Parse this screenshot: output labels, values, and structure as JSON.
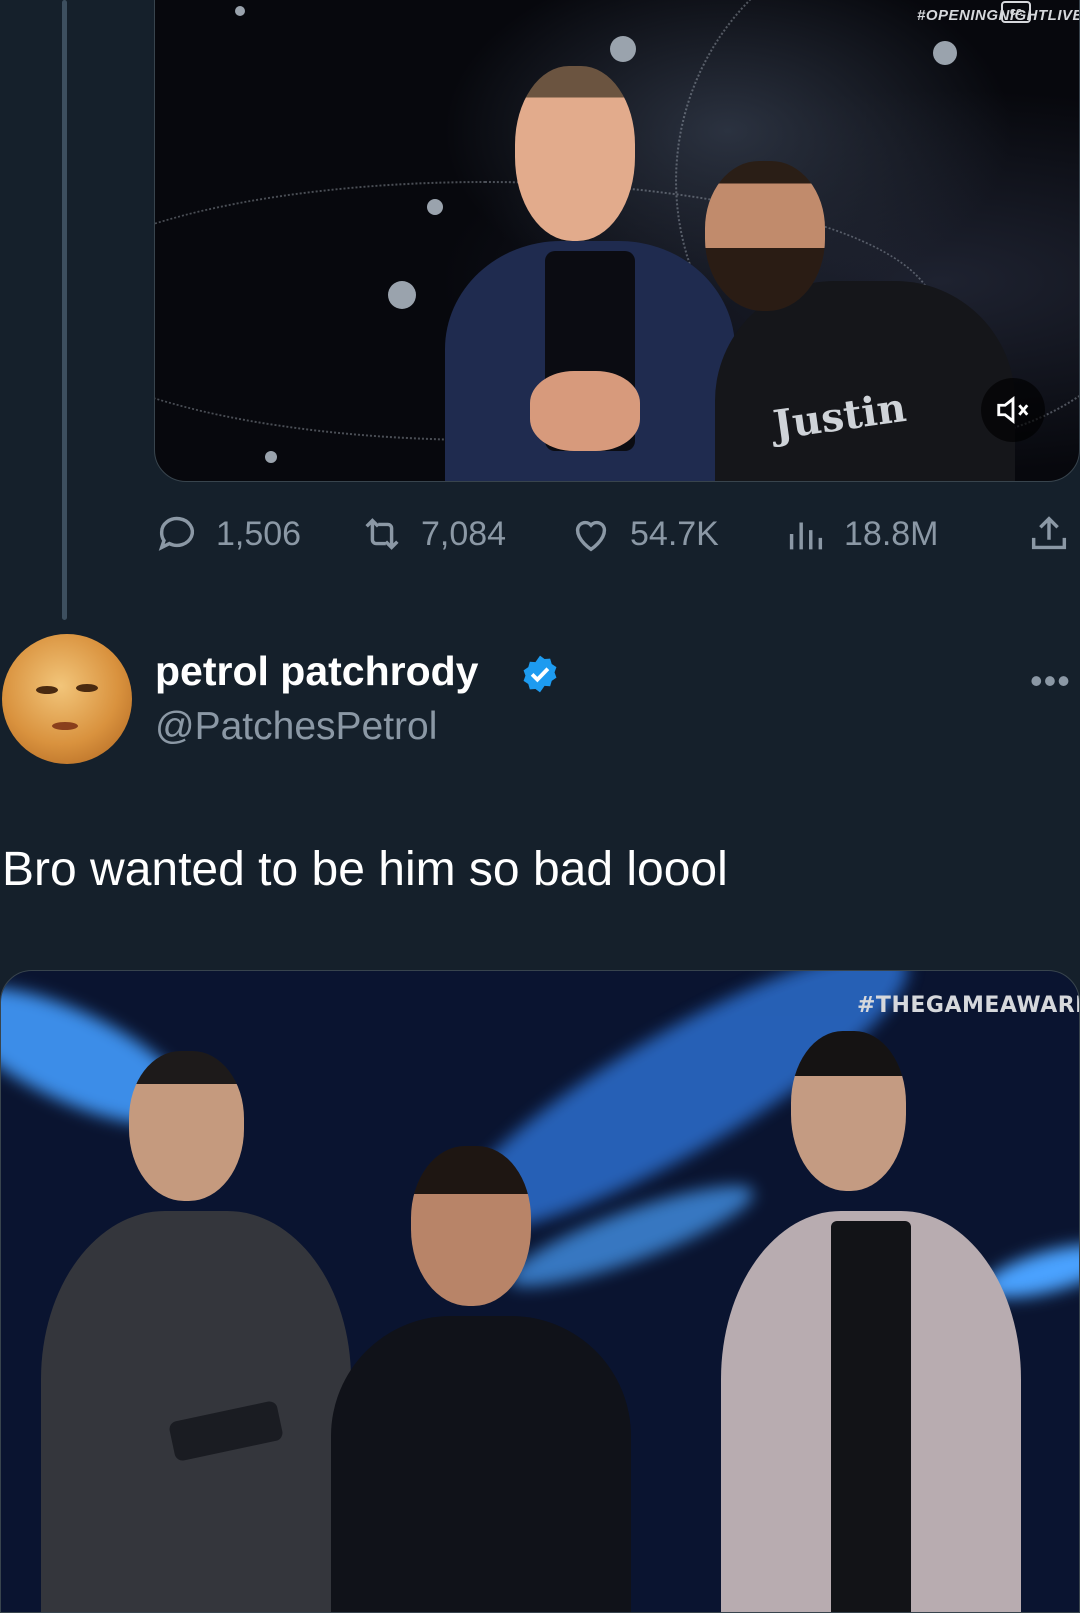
{
  "top_media": {
    "watermark": "#OPENINGNIGHTLIVE",
    "shirt_text": "Justin",
    "mute_icon": "speaker-muted-icon",
    "cc_icon": "closed-caption-icon"
  },
  "actions": {
    "reply": {
      "icon": "reply-bubble-icon",
      "count": "1,506"
    },
    "retweet": {
      "icon": "retweet-icon",
      "count": "7,084"
    },
    "like": {
      "icon": "heart-icon",
      "count": "54.7K"
    },
    "views": {
      "icon": "bar-chart-icon",
      "count": "18.8M"
    },
    "share": {
      "icon": "share-upload-icon"
    }
  },
  "reply_tweet": {
    "display_name": "petrol patchrody",
    "handle": "@PatchesPetrol",
    "verified": true,
    "more_label": "•••",
    "text": "Bro wanted to be him so bad loool"
  },
  "bottom_media": {
    "watermark": "#THEGAMEAWARDS"
  },
  "colors": {
    "background": "#15202b",
    "secondary_text": "#8b98a5",
    "verified_blue": "#1d9bf0",
    "thread_line": "#3d4f5f"
  }
}
